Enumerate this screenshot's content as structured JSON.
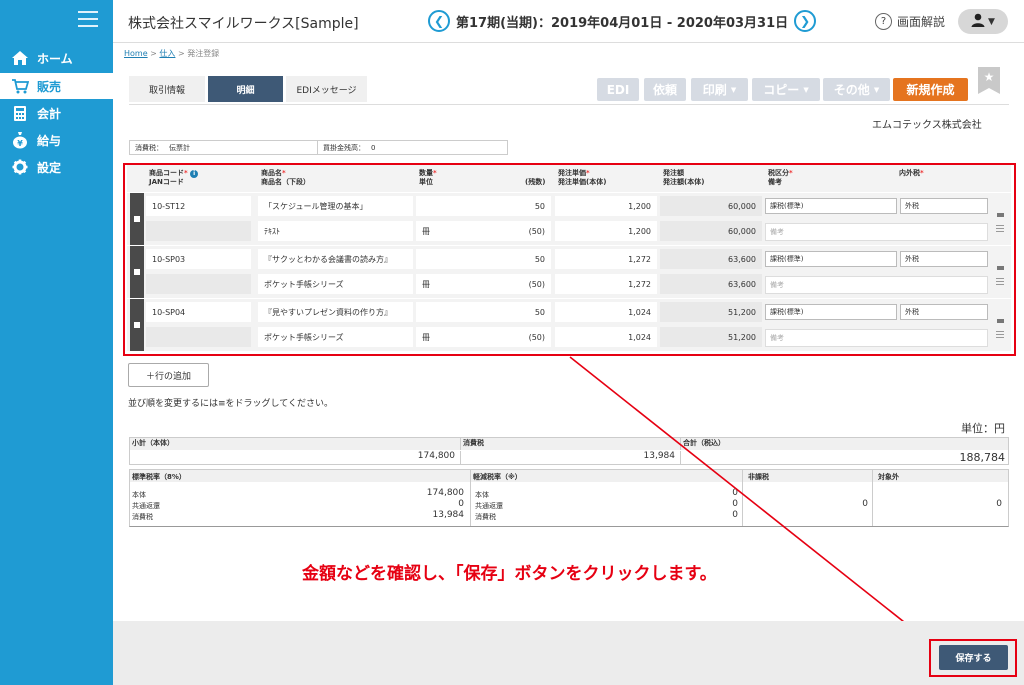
{
  "app": {
    "company": "株式会社スマイルワークス[Sample]",
    "period": "第17期(当期)：2019年04月01日 - 2020年03月31日",
    "help": "画面解説"
  },
  "icons": {
    "menu": "hamburger-icon",
    "prev": "chevron-left-icon",
    "next": "chevron-right-icon",
    "help": "question-icon",
    "user": "user-icon",
    "star": "star-icon",
    "drag": "drag-handle-icon"
  },
  "sidebar": {
    "items": [
      {
        "label": "ホーム",
        "icon": "home-icon"
      },
      {
        "label": "販売",
        "icon": "cart-icon"
      },
      {
        "label": "会計",
        "icon": "calculator-icon"
      },
      {
        "label": "給与",
        "icon": "money-bag-icon"
      },
      {
        "label": "設定",
        "icon": "gear-icon"
      }
    ]
  },
  "breadcrumb": {
    "home": "Home",
    "sep1": " > ",
    "purchase": "仕入",
    "sep2": " > ",
    "current": "発注登録"
  },
  "tabs": [
    {
      "label": "取引情報"
    },
    {
      "label": "明細"
    },
    {
      "label": "EDIメッセージ"
    }
  ],
  "toolbar": {
    "edi": "EDI",
    "request": "依頼",
    "print": "印刷",
    "copy": "コピー",
    "other": "その他",
    "new": "新規作成"
  },
  "vendor": "エムコテックス株式会社",
  "info": {
    "tax_label": "消費税：",
    "tax_value": "伝票計",
    "balance_label": "買掛金残高：",
    "balance_value": "0"
  },
  "columns": {
    "code": "商品コード",
    "jan": "JANコード",
    "name": "商品名",
    "name2": "商品名（下段）",
    "qty": "数量",
    "unit": "単位",
    "remaining": "(残数)",
    "price": "発注単価",
    "price2": "発注単価(本体)",
    "amount": "発注額",
    "amount2": "発注額(本体)",
    "taxcat": "税区分",
    "memo": "備考",
    "taxinout": "内外税"
  },
  "rows": [
    {
      "code": "10-ST12",
      "name": "「スケジュール管理の基本」",
      "name2": "ﾃｷｽﾄ",
      "qty": "50",
      "unit": "冊",
      "remaining": "(50)",
      "price": "1,200",
      "price2": "1,200",
      "amount": "60,000",
      "amount2": "60,000",
      "taxcat": "課税(標準)",
      "taxinout": "外税",
      "memo": "備考"
    },
    {
      "code": "10-SP03",
      "name": "『サクッとわかる会議書の読み方』",
      "name2": "ポケット手帳シリーズ",
      "qty": "50",
      "unit": "冊",
      "remaining": "(50)",
      "price": "1,272",
      "price2": "1,272",
      "amount": "63,600",
      "amount2": "63,600",
      "taxcat": "課税(標準)",
      "taxinout": "外税",
      "memo": "備考"
    },
    {
      "code": "10-SP04",
      "name": "『見やすいプレゼン資料の作り方』",
      "name2": "ポケット手帳シリーズ",
      "qty": "50",
      "unit": "冊",
      "remaining": "(50)",
      "price": "1,024",
      "price2": "1,024",
      "amount": "51,200",
      "amount2": "51,200",
      "taxcat": "課税(標準)",
      "taxinout": "外税",
      "memo": "備考"
    }
  ],
  "add_row": "＋行の追加",
  "drag_note": "並び順を変更するには≡をドラッグしてください。",
  "unit_label": "単位：円",
  "totals": {
    "subtotal_label": "小計（本体）",
    "subtotal": "174,800",
    "tax_label": "消費税",
    "tax": "13,984",
    "total_label": "合計（税込）",
    "total": "188,784"
  },
  "tax_breakdown": {
    "standard_label": "標準税率（8%）",
    "reduced_label": "軽減税率（※）",
    "exempt_label": "非課税",
    "outside_label": "対象外",
    "body_label": "本体",
    "common_label": "共通返還",
    "ctax_label": "消費税",
    "std_body": "174,800",
    "std_common": "0",
    "std_tax": "13,984",
    "red_body": "0",
    "red_common": "0",
    "red_tax": "0",
    "exempt": "0",
    "outside": "0"
  },
  "instruction": "金額などを確認し、「保存」ボタンをクリックします。",
  "save": "保存する",
  "colors": {
    "sidebar": "#1f9bd3",
    "active_tab": "#3e5976",
    "new_button": "#e5741f",
    "disabled_button": "#d6dbe3",
    "highlight": "#e60012"
  }
}
